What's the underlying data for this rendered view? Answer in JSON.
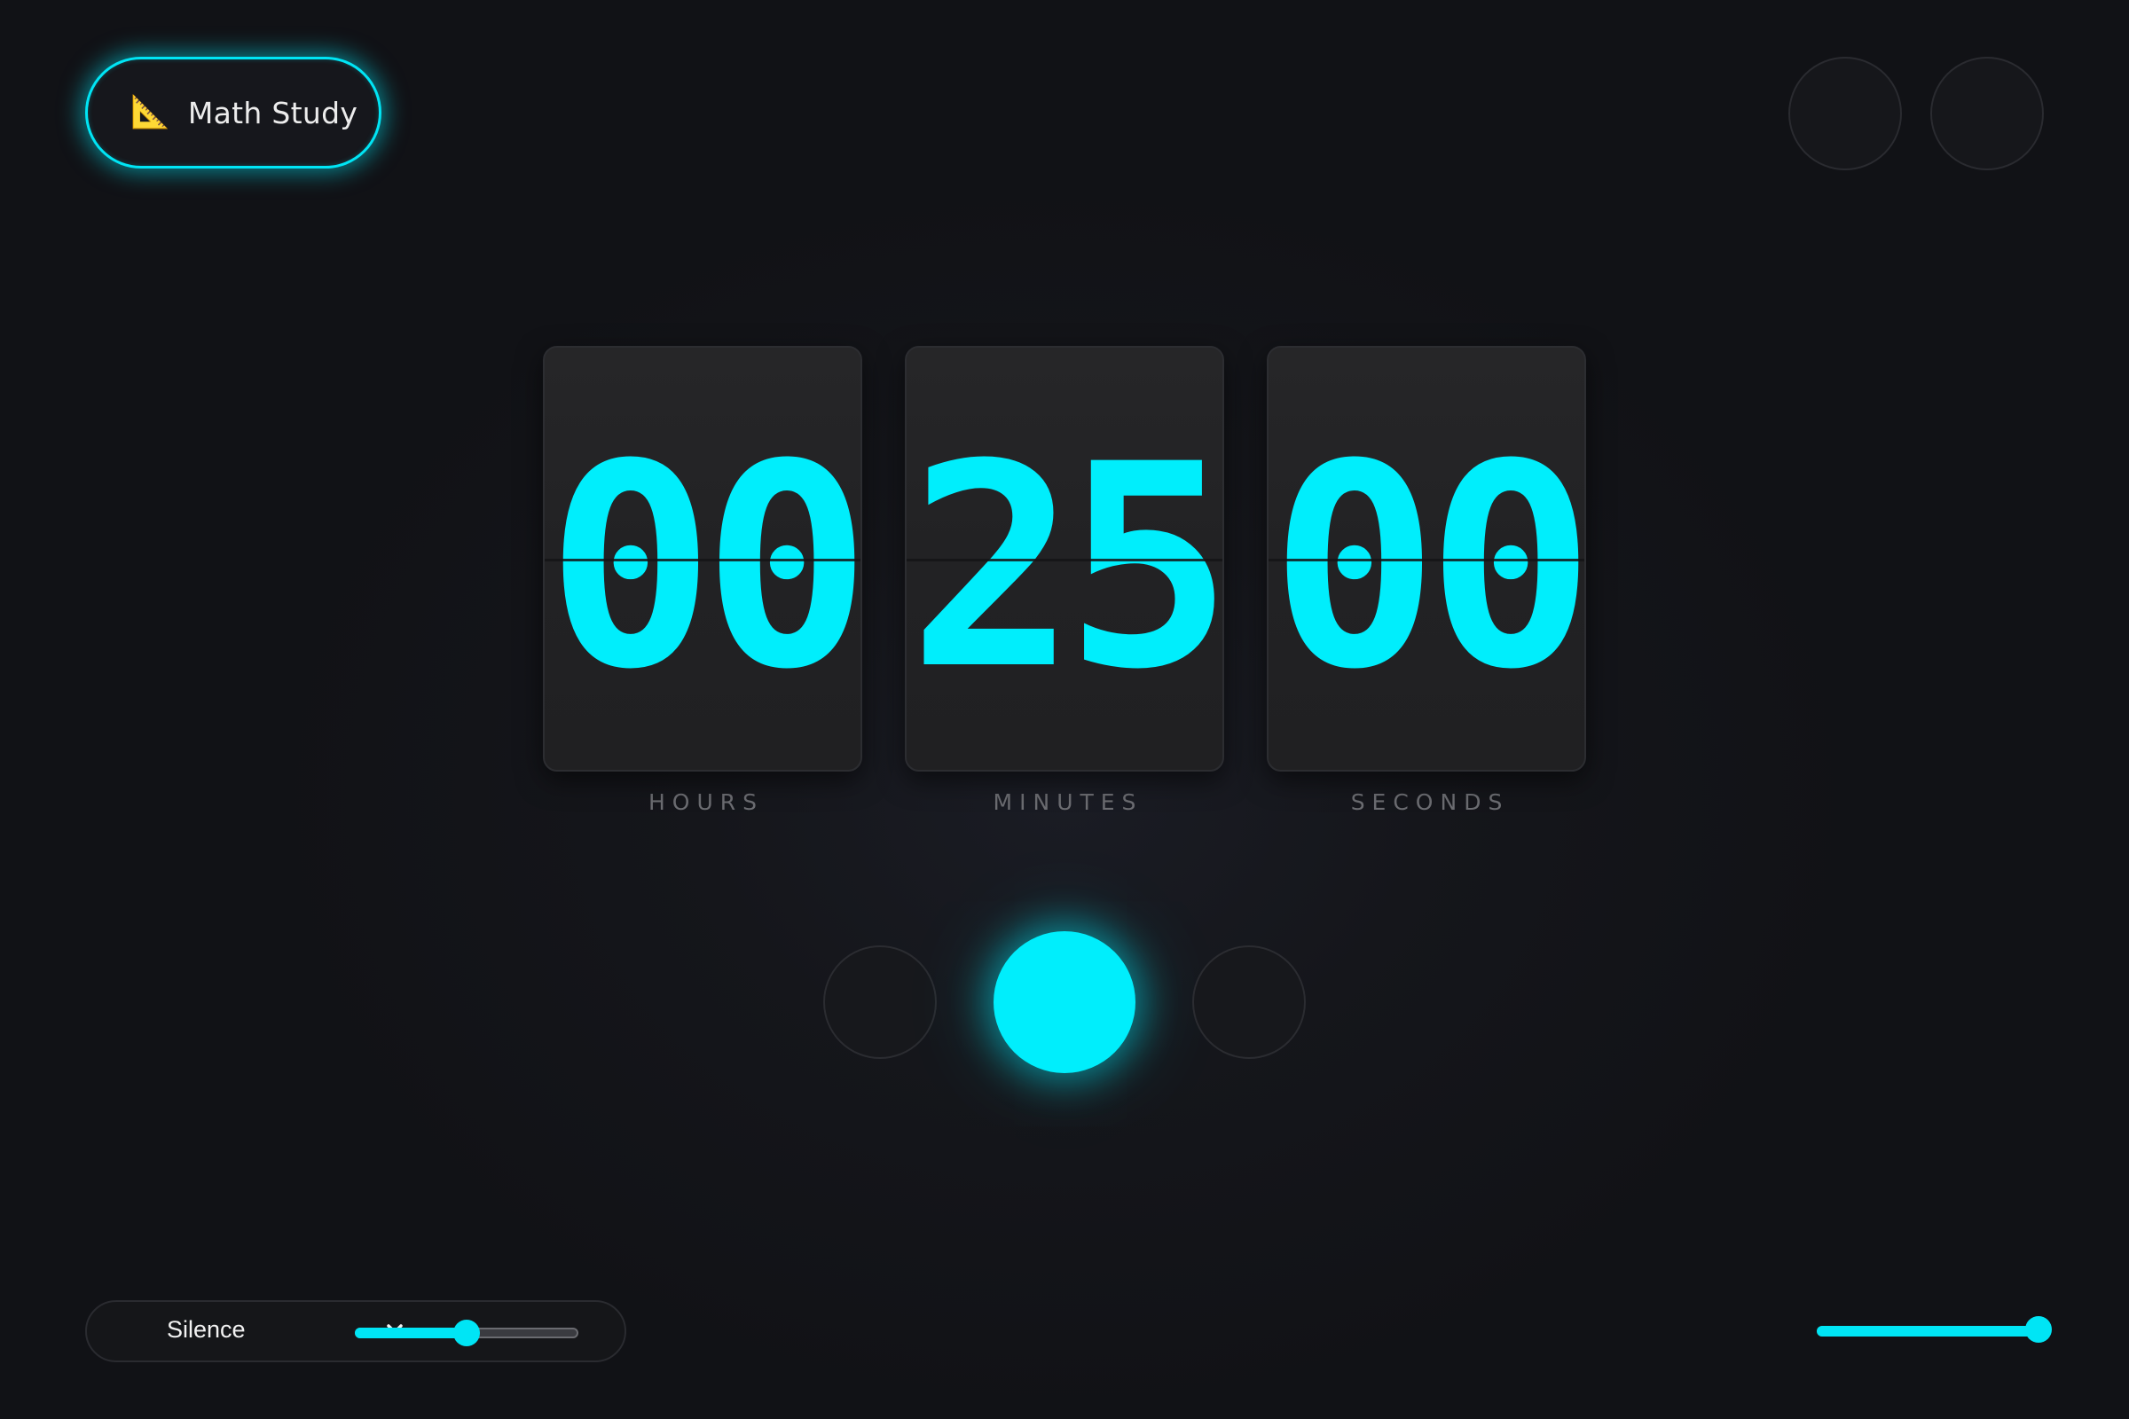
{
  "session": {
    "emoji": "📐",
    "label": "Math Study"
  },
  "timer": {
    "hours": "00",
    "minutes": "25",
    "seconds": "00",
    "hours_label": "HOURS",
    "minutes_label": "MINUTES",
    "seconds_label": "SECONDS"
  },
  "sound": {
    "selected": "Silence",
    "volume_fraction": 0.5
  },
  "secondary_slider": {
    "value_fraction": 1.0
  },
  "colors": {
    "accent": "#00eefc",
    "background": "#111216",
    "card": "#232325",
    "label": "#6c6d72"
  },
  "icons": {
    "session": "triangular-ruler-emoji",
    "sound_dropdown": "chevron-down-icon"
  }
}
